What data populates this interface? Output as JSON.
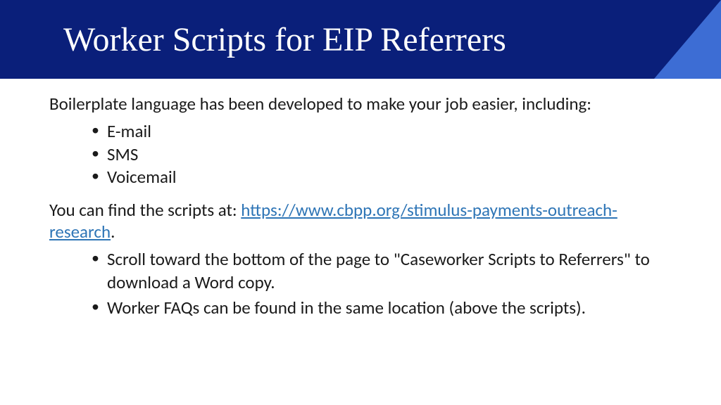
{
  "header": {
    "title": "Worker Scripts for EIP Referrers"
  },
  "body": {
    "intro": "Boilerplate language has been developed to make your job easier, including:",
    "channels": [
      "E-mail",
      "SMS",
      "Voicemail"
    ],
    "find_prefix": "You can find the scripts at: ",
    "link_text": "https://www.cbpp.org/stimulus-payments-outreach-research",
    "find_suffix": ".",
    "instructions": [
      "Scroll toward the bottom of the page to \"Caseworker Scripts to Referrers\" to download a Word copy.",
      "Worker FAQs can be found in the same location (above the scripts)."
    ]
  }
}
